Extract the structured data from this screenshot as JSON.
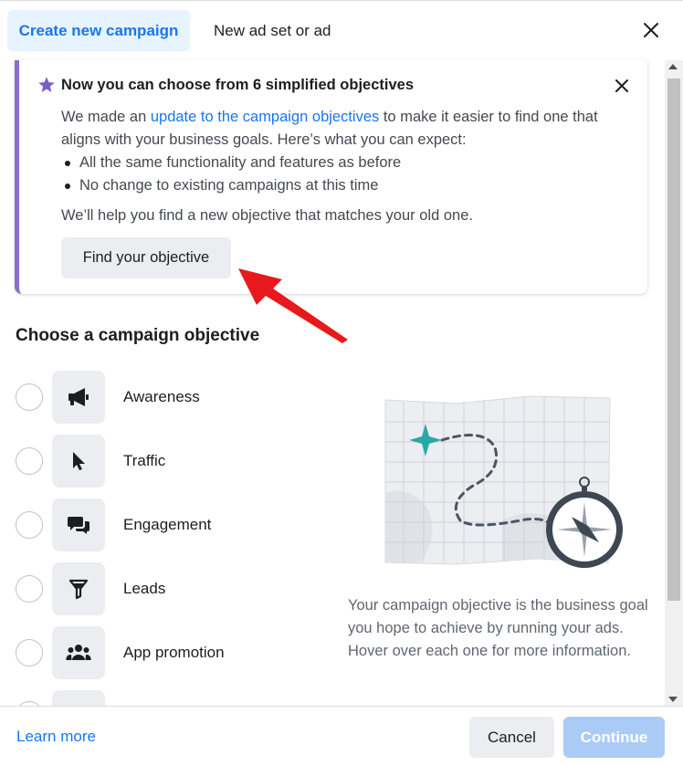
{
  "header": {
    "tabs": [
      {
        "label": "Create new campaign",
        "active": true
      },
      {
        "label": "New ad set or ad",
        "active": false
      }
    ],
    "close_icon": "close-icon"
  },
  "notice": {
    "icon": "star-icon",
    "title": "Now you can choose from 6 simplified objectives",
    "body_prefix": "We made an ",
    "body_link": "update to the campaign objectives",
    "body_suffix": " to make it easier to find one that aligns with your business goals. Here’s what you can expect:",
    "bullets": [
      "All the same functionality and features as before",
      "No change to existing campaigns at this time"
    ],
    "footer_text": "We’ll help you find a new objective that matches your old one.",
    "button_label": "Find your objective",
    "accent_color": "#8b6fc9"
  },
  "objectives": {
    "title": "Choose a campaign objective",
    "items": [
      {
        "label": "Awareness",
        "icon": "megaphone-icon"
      },
      {
        "label": "Traffic",
        "icon": "cursor-icon"
      },
      {
        "label": "Engagement",
        "icon": "chat-bubbles-icon"
      },
      {
        "label": "Leads",
        "icon": "funnel-icon"
      },
      {
        "label": "App promotion",
        "icon": "people-icon"
      }
    ]
  },
  "description": "Your campaign objective is the business goal you hope to achieve by running your ads. Hover over each one for more information.",
  "footer": {
    "learn_more": "Learn more",
    "cancel": "Cancel",
    "continue": "Continue"
  },
  "colors": {
    "brand_blue": "#1877f2",
    "active_tab_bg": "#e7f3ff",
    "continue_disabled": "#aacbf5",
    "annotation_arrow": "#e8191c"
  }
}
